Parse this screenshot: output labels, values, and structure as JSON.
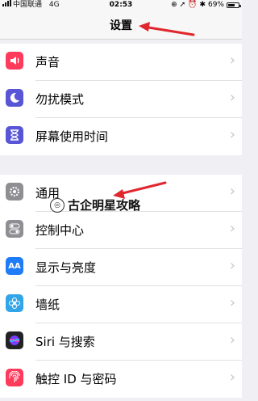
{
  "status_bar": {
    "carrier": "中国联通",
    "network": "4G",
    "time": "02:53",
    "battery": "69%",
    "battery_level": 0.69
  },
  "nav": {
    "title": "设置"
  },
  "group1": [
    {
      "label": "声音",
      "icon": "speaker-icon",
      "color": "#ff3b5c"
    },
    {
      "label": "勿扰模式",
      "icon": "moon-icon",
      "color": "#5856d6"
    },
    {
      "label": "屏幕使用时间",
      "icon": "hourglass-icon",
      "color": "#5856d6"
    }
  ],
  "group2": [
    {
      "label": "通用",
      "icon": "gear-icon",
      "color": "#8e8e93"
    },
    {
      "label": "控制中心",
      "icon": "toggles-icon",
      "color": "#8e8e93"
    },
    {
      "label": "显示与亮度",
      "icon": "text-size-icon",
      "color": "#1e7cf6"
    },
    {
      "label": "墙纸",
      "icon": "flower-icon",
      "color": "#31a5e8"
    },
    {
      "label": "Siri 与搜索",
      "icon": "siri-icon",
      "color": "#222"
    },
    {
      "label": "触控 ID 与密码",
      "icon": "fingerprint-icon",
      "color": "#ff3b5c"
    }
  ],
  "watermark": {
    "text": "古企明星攻略"
  },
  "colors": {
    "arrow": "#e0272d"
  }
}
